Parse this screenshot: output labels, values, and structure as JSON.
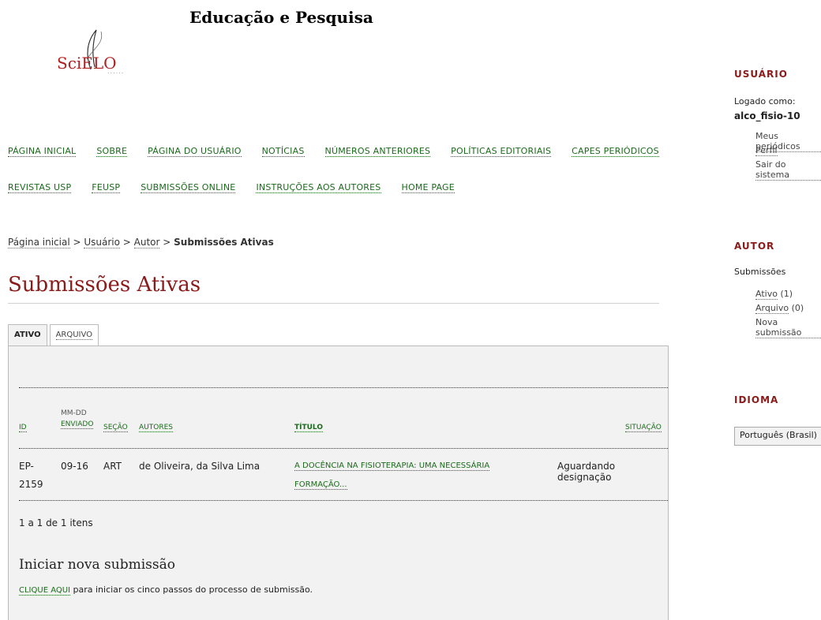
{
  "header": {
    "journal_title": "Educação e Pesquisa",
    "logo_text": "SciELO",
    "logo_dots": "......"
  },
  "nav": {
    "row1": [
      "PÁGINA INICIAL",
      "SOBRE",
      "PÁGINA DO USUÁRIO",
      "NOTÍCIAS",
      "NÚMEROS ANTERIORES",
      "POLÍTICAS EDITORIAIS",
      "CAPES PERIÓDICOS"
    ],
    "row2": [
      "REVISTAS USP",
      "FEUSP",
      "SUBMISSÕES ONLINE",
      "INSTRUÇÕES AOS AUTORES",
      "HOME PAGE"
    ]
  },
  "breadcrumb": {
    "home": "Página inicial",
    "user": "Usuário",
    "author": "Autor",
    "current": "Submissões Ativas",
    "sep": " > "
  },
  "page_title": "Submissões Ativas",
  "tabs": {
    "active": "ATIVO",
    "archive": "ARQUIVO"
  },
  "table": {
    "headers": {
      "id": "ID",
      "date_top": "MM-DD",
      "date_bottom": "ENVIADO",
      "section": "SEÇÃO",
      "authors": "AUTORES",
      "title": "TÍTULO",
      "status": "SITUAÇÃO"
    },
    "rows": [
      {
        "id_line1": "EP-",
        "id_line2": "2159",
        "date": "09-16",
        "section": "ART",
        "authors": "de Oliveira, da Silva Lima",
        "title_line1": "A DOCÊNCIA NA FISIOTERAPIA: UMA NECESSÁRIA",
        "title_line2": "FORMAÇÃO...",
        "status": "Aguardando designação"
      }
    ],
    "count": "1 a 1 de 1 itens"
  },
  "new_submission": {
    "title": "Iniciar nova submissão",
    "link": "CLIQUE AQUI",
    "text": " para iniciar os cinco passos do processo de submissão."
  },
  "sidebar": {
    "user": {
      "heading": "USUÁRIO",
      "logged_as": "Logado como:",
      "username": "alco_fisio-10",
      "links": [
        "Meus periódicos",
        "Perfil",
        "Sair do sistema"
      ]
    },
    "author": {
      "heading": "AUTOR",
      "label": "Submissões",
      "active_link": "Ativo",
      "active_count": " (1)",
      "archive_link": "Arquivo",
      "archive_count": " (0)",
      "new_link": "Nova submissão"
    },
    "language": {
      "heading": "IDIOMA",
      "selected": "Português (Brasil)"
    }
  }
}
